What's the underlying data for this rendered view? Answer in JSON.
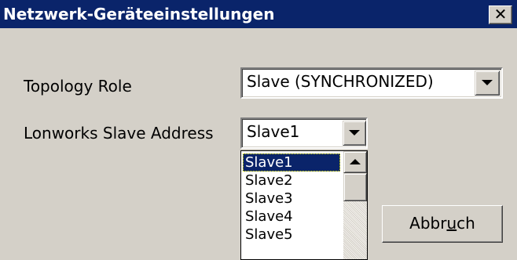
{
  "window": {
    "title": "Netzwerk-Geräteeinstellungen",
    "close_glyph": "✕",
    "colors": {
      "titlebar": "#0a246a",
      "face": "#d4d0c8",
      "selection": "#0a246a"
    }
  },
  "topology": {
    "label": "Topology Role",
    "selected": "Slave (SYNCHRONIZED)"
  },
  "slave_address": {
    "label": "Lonworks Slave Address",
    "selected": "Slave1",
    "options": [
      "Slave1",
      "Slave2",
      "Slave3",
      "Slave4",
      "Slave5"
    ],
    "selected_index": 0
  },
  "buttons": {
    "cancel_pre": "Abbr",
    "cancel_mnemonic": "u",
    "cancel_post": "ch"
  },
  "icons": {
    "close": "close-icon",
    "dropdown": "chevron-down-icon",
    "scroll_up": "scroll-up-arrow-icon"
  }
}
